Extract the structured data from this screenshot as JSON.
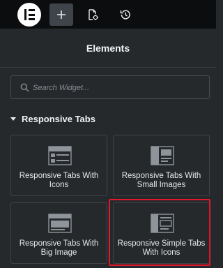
{
  "topbar": {
    "logo_icon": "elementor-logo",
    "buttons": [
      {
        "name": "add-element",
        "icon": "plus-icon"
      },
      {
        "name": "page-settings",
        "icon": "page-settings-icon"
      },
      {
        "name": "history",
        "icon": "history-icon"
      }
    ]
  },
  "panel": {
    "title": "Elements"
  },
  "search": {
    "placeholder": "Search Widget...",
    "value": ""
  },
  "category": {
    "title": "Responsive Tabs",
    "expanded": true
  },
  "widgets": [
    {
      "label": "Responsive Tabs With Icons",
      "icon": "tabs-icons-widget-icon",
      "highlighted": false
    },
    {
      "label": "Responsive Tabs With Small Images",
      "icon": "tabs-small-images-widget-icon",
      "highlighted": false
    },
    {
      "label": "Responsive Tabs With Big Image",
      "icon": "tabs-big-image-widget-icon",
      "highlighted": false
    },
    {
      "label": "Responsive Simple Tabs With Icons",
      "icon": "simple-tabs-icons-widget-icon",
      "highlighted": true
    }
  ],
  "colors": {
    "topbar_bg": "#0c0d0e",
    "panel_bg": "#26292c",
    "card_border": "#3f4348",
    "highlight": "#e3162b",
    "text": "#e6e8ea"
  }
}
